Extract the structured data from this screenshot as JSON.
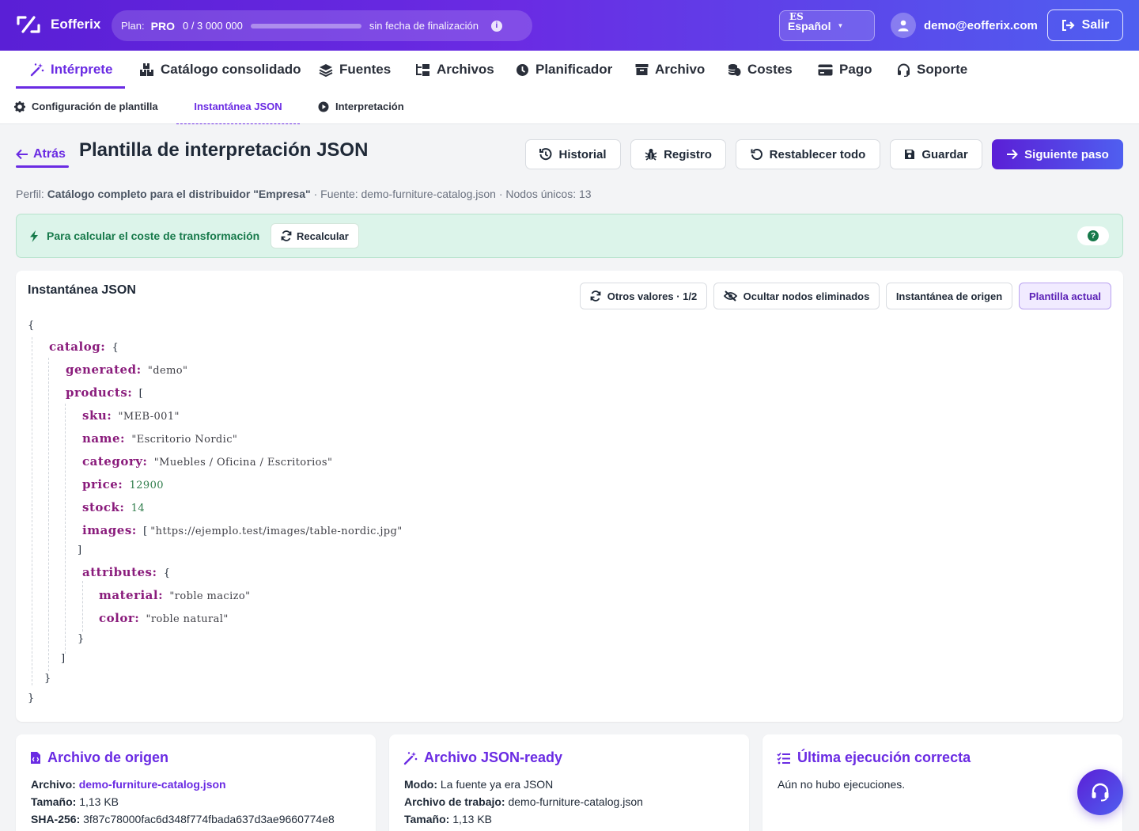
{
  "app": {
    "name": "Eofferix"
  },
  "plan": {
    "label": "Plan:",
    "tier": "PRO",
    "usage": "0 / 3 000 000",
    "usage_fraction": 0,
    "end": "sin fecha de finalización"
  },
  "language": {
    "code": "ES",
    "name": "Español"
  },
  "user": {
    "email": "demo@eofferix.com",
    "logout": "Salir"
  },
  "nav": {
    "items": [
      {
        "label": "Intérprete",
        "active": true
      },
      {
        "label": "Catálogo consolidado"
      },
      {
        "label": "Fuentes"
      },
      {
        "label": "Archivos"
      },
      {
        "label": "Planificador"
      },
      {
        "label": "Archivo"
      },
      {
        "label": "Costes"
      },
      {
        "label": "Pago"
      },
      {
        "label": "Soporte"
      }
    ]
  },
  "subnav": {
    "items": [
      {
        "label": "Configuración de plantilla"
      },
      {
        "label": "Instantánea JSON",
        "active": true
      },
      {
        "label": "Interpretación"
      }
    ]
  },
  "header": {
    "back": "Atrás",
    "title": "Plantilla de interpretación JSON",
    "buttons": {
      "history": "Historial",
      "log": "Registro",
      "reset": "Restablecer todo",
      "save": "Guardar",
      "next": "Siguiente paso"
    }
  },
  "meta": {
    "profile_label": "Perfil:",
    "profile": "Catálogo completo para el distribuidor \"Empresa\"",
    "source": " · Fuente: demo-furniture-catalog.json · Nodos únicos: 13"
  },
  "alert": {
    "text": "Para calcular el coste de transformación",
    "recalc": "Recalcular",
    "help": "?"
  },
  "snapshot": {
    "title": "Instantánea JSON",
    "buttons": {
      "other_values": "Otros valores · 1/2",
      "hide_deleted": "Ocultar nodos eliminados",
      "source_snapshot": "Instantánea de origen",
      "current_template": "Plantilla actual"
    },
    "tokens": {
      "open_obj": "{",
      "close_obj": "}",
      "open_arr": "[",
      "close_arr": "]",
      "catalog": "catalog:",
      "generated": "generated:",
      "generated_val": "\"demo\"",
      "products": "products:",
      "sku": "sku:",
      "sku_val": "\"MEB-001\"",
      "name": "name:",
      "name_val": "\"Escritorio Nordic\"",
      "category": "category:",
      "category_val": "\"Muebles / Oficina / Escritorios\"",
      "price": "price:",
      "price_val": "12900",
      "stock": "stock:",
      "stock_val": "14",
      "images": "images:",
      "images_val": "\"https://ejemplo.test/images/table-nordic.jpg\"",
      "attributes": "attributes:",
      "material": "material:",
      "material_val": "\"roble macizo\"",
      "color": "color:",
      "color_val": "\"roble natural\""
    }
  },
  "source_file": {
    "title": "Archivo de origen",
    "file_label": "Archivo:",
    "file": "demo-furniture-catalog.json",
    "size_label": "Tamaño:",
    "size": "1,13 KB",
    "sha_label": "SHA-256:",
    "sha": "3f87c78000fac6d348f774fbada637d3ae9660774e8"
  },
  "json_ready": {
    "title": "Archivo JSON-ready",
    "mode_label": "Modo:",
    "mode": "La fuente ya era JSON",
    "work_label": "Archivo de trabajo:",
    "work": "demo-furniture-catalog.json",
    "size_label": "Tamaño:",
    "size": "1,13 KB"
  },
  "last_run": {
    "title": "Última ejecución correcta",
    "text": "Aún no hubo ejecuciones."
  },
  "colors": {
    "brand": "#6a2be3",
    "success": "#16794a",
    "key": "#8a1c7c",
    "number": "#2f7d4b"
  },
  "icons": {
    "fab": "headset-icon",
    "logo": "logo-icon"
  }
}
